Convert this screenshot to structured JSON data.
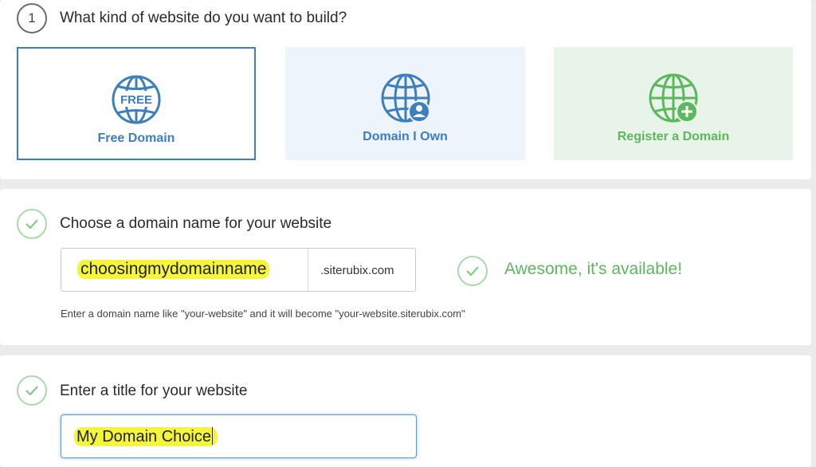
{
  "step1": {
    "number": "1",
    "title": "What kind of website do you want to build?",
    "options": [
      {
        "label": "Free Domain",
        "icon": "globe-free-icon",
        "badge": "FREE",
        "color": "#3d7ebd",
        "selected": true
      },
      {
        "label": "Domain I Own",
        "icon": "globe-user-icon",
        "color": "#3d7ebd",
        "selected": false
      },
      {
        "label": "Register a Domain",
        "icon": "globe-plus-icon",
        "color": "#5cb85c",
        "selected": false
      }
    ]
  },
  "step2": {
    "status_icon": "check-circle-icon",
    "title": "Choose a domain name for your website",
    "domain_value": "choosingmydomainname",
    "domain_suffix": ".siterubix.com",
    "availability_icon": "check-circle-icon",
    "availability_text": "Awesome, it's available!",
    "hint": "Enter a domain name like \"your-website\" and it will become \"your-website.siterubix.com\""
  },
  "step3": {
    "status_icon": "check-circle-icon",
    "title": "Enter a title for your website",
    "title_value": "My Domain Choice"
  },
  "colors": {
    "blue": "#3d7ebd",
    "green": "#5cb85c",
    "highlight": "#f5f53a"
  }
}
